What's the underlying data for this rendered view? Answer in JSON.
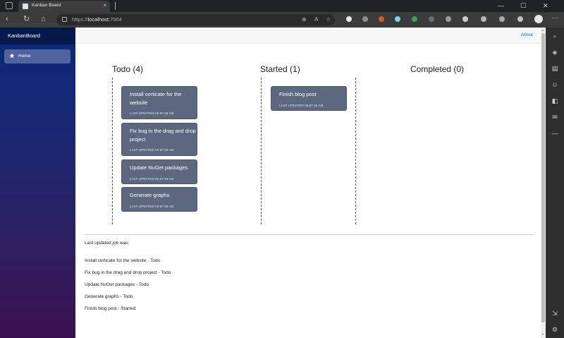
{
  "browser": {
    "tab_title": "Kanban Board",
    "tab_close": "×",
    "new_tab": "|",
    "url_prefix": "https://",
    "url_host": "localhost",
    "url_rest": ":7004",
    "controls": {
      "minimize": "—",
      "maximize": "☐",
      "close": "✕",
      "menu": "···"
    }
  },
  "app": {
    "brand": "KanbanBoard",
    "nav": {
      "home": "Home"
    },
    "about": "About"
  },
  "board": {
    "columns": [
      {
        "title": "Todo (4)"
      },
      {
        "title": "Started (1)"
      },
      {
        "title": "Completed (0)"
      }
    ],
    "cards": [
      {
        "title": "Install certicate for the website",
        "meta": "LAST UPDATED 06:57:26 AM"
      },
      {
        "title": "Fix bug in the drag and drop project",
        "meta": "LAST UPDATED 06:57:26 AM"
      },
      {
        "title": "Update NuGet packages",
        "meta": "LAST UPDATED 06:57:26 AM"
      },
      {
        "title": "Generate graphs",
        "meta": "LAST UPDATED 06:57:26 AM"
      },
      {
        "title": "Finish blog post",
        "meta": "LAST UPDATED 06:57:26 AM"
      }
    ]
  },
  "log": {
    "title": "Last updated job was:",
    "items": [
      "Install certicate for the website - Todo",
      "Fix bug in the drag and drop project - Todo",
      "Update NuGet packages - Todo",
      "Generate graphs - Todo",
      "Finish blog post - Started"
    ]
  },
  "icons": {
    "back": "back-arrow-icon",
    "refresh": "refresh-icon",
    "home": "home-icon",
    "lock": "lock-icon",
    "favorites": "star-icon",
    "settings": "gear-icon"
  },
  "colors": {
    "card": "#5c6780",
    "sidebar_top": "#0b2779",
    "sidebar_bottom": "#3a1150",
    "link": "#1b6ec2"
  }
}
